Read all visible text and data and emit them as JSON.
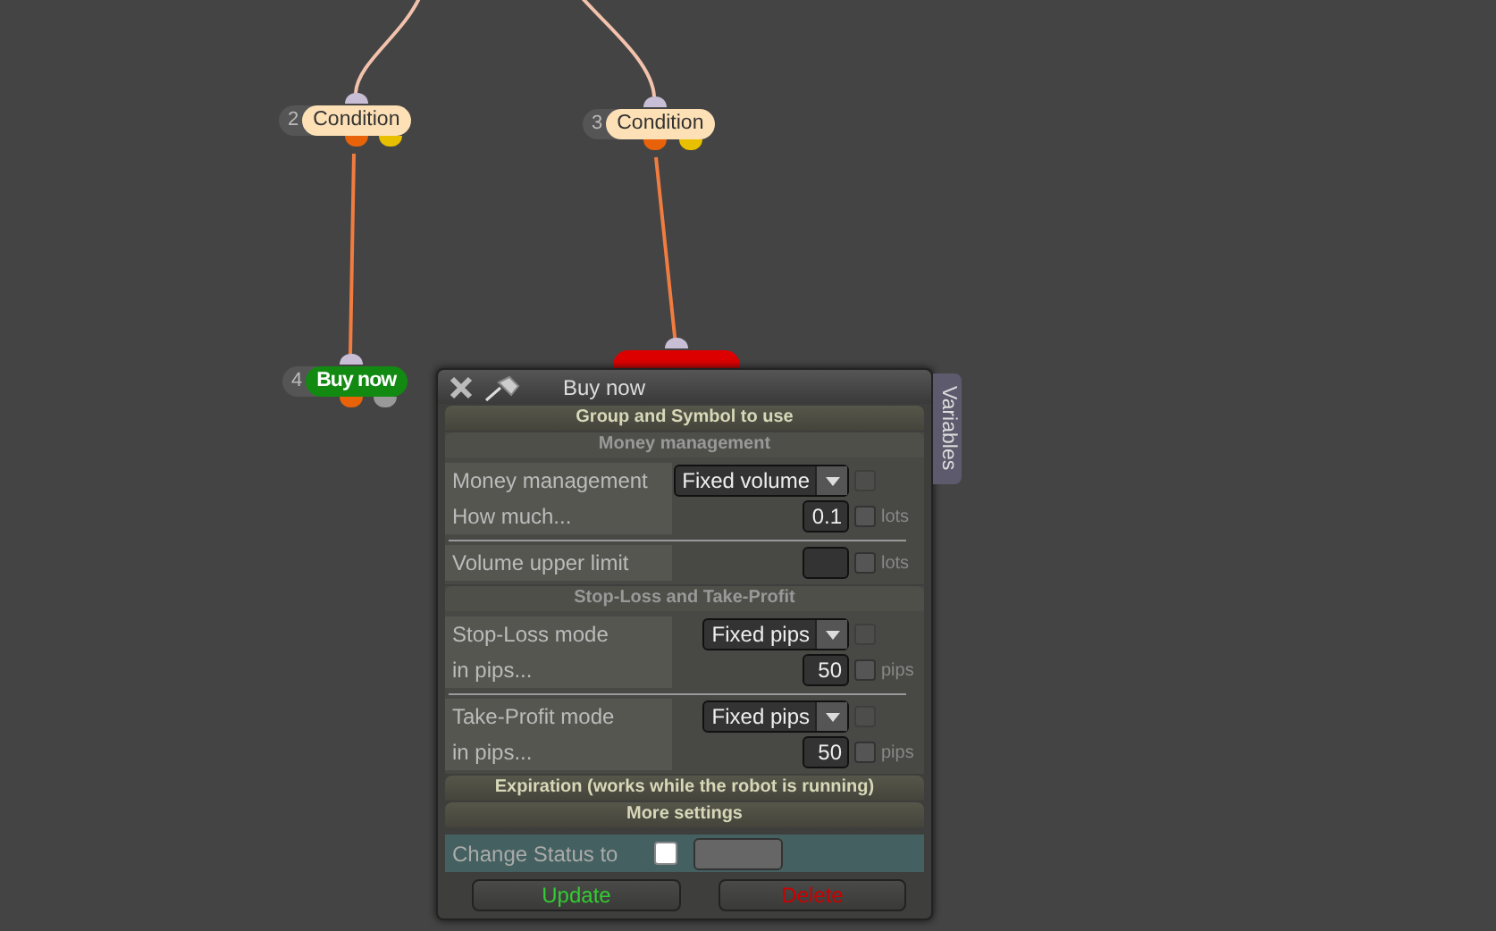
{
  "nodes": [
    {
      "kind": "condition",
      "number": "2",
      "label": "Condition"
    },
    {
      "kind": "condition",
      "number": "3",
      "label": "Condition"
    },
    {
      "kind": "buy",
      "number": "4",
      "label": "Buy now"
    },
    {
      "kind": "sell"
    }
  ],
  "dialog": {
    "title": "Buy now",
    "side_tab": "Variables",
    "sections": [
      {
        "kind": "header",
        "title": "Group and Symbol to use"
      },
      {
        "kind": "group",
        "title": "Money management",
        "blocks": [
          {
            "rows": [
              {
                "kind": "select",
                "label": "Money management",
                "value": "Fixed volume",
                "checked": false
              },
              {
                "kind": "number",
                "label": "How much...",
                "value": "0.1",
                "unit": "lots",
                "checked": false
              }
            ]
          },
          {
            "rows": [
              {
                "kind": "number",
                "label": "Volume upper limit",
                "unit": "lots",
                "checked": false
              }
            ]
          }
        ]
      },
      {
        "kind": "group",
        "title": "Stop-Loss and Take-Profit",
        "blocks": [
          {
            "rows": [
              {
                "kind": "select",
                "label": "Stop-Loss mode",
                "value": "Fixed pips",
                "checked": false
              },
              {
                "kind": "number",
                "label": "in pips...",
                "value": "50",
                "unit": "pips",
                "checked": false
              }
            ]
          },
          {
            "rows": [
              {
                "kind": "select",
                "label": "Take-Profit mode",
                "value": "Fixed pips",
                "checked": false
              },
              {
                "kind": "number",
                "label": "in pips...",
                "value": "50",
                "unit": "pips",
                "checked": false
              }
            ]
          }
        ]
      },
      {
        "kind": "header",
        "title": "Expiration (works while the robot is running)"
      },
      {
        "kind": "header",
        "title": "More settings"
      }
    ],
    "status": {
      "label": "Change Status to",
      "checked": false
    },
    "buttons": [
      {
        "kind": "update",
        "label": "Update"
      },
      {
        "kind": "delete",
        "label": "Delete"
      }
    ]
  }
}
